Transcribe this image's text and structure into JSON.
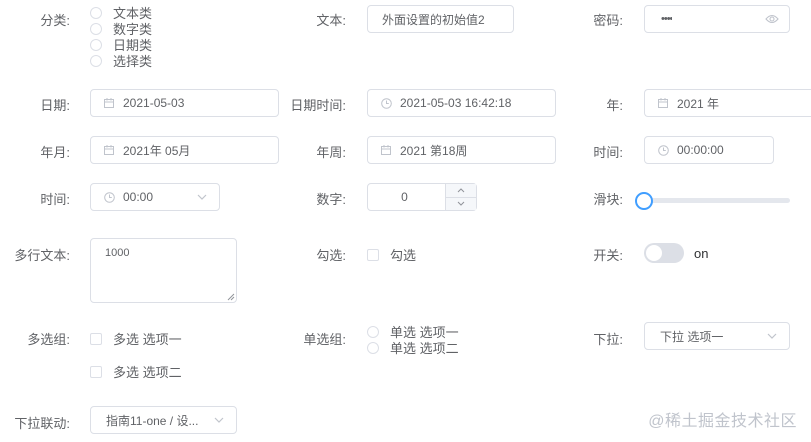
{
  "form": {
    "category": {
      "label": "分类:",
      "options": [
        "文本类",
        "数字类",
        "日期类",
        "选择类"
      ]
    },
    "text": {
      "label": "文本:",
      "value": "外面设置的初始值2"
    },
    "password": {
      "label": "密码:",
      "value": "••••",
      "icon": "eye-icon"
    },
    "date": {
      "label": "日期:",
      "value": "2021-05-03",
      "icon": "calendar-icon"
    },
    "datetime": {
      "label": "日期时间:",
      "value": "2021-05-03 16:42:18",
      "icon": "clock-icon"
    },
    "year": {
      "label": "年:",
      "value": "2021 年",
      "icon": "calendar-icon"
    },
    "month": {
      "label": "年月:",
      "value": "2021年 05月",
      "icon": "calendar-icon"
    },
    "week": {
      "label": "年周:",
      "value": "2021 第18周",
      "icon": "calendar-icon"
    },
    "time": {
      "label": "时间:",
      "value": "00:00:00",
      "icon": "clock-icon"
    },
    "time_select": {
      "label": "时间:",
      "value": "00:00",
      "icon": "clock-icon"
    },
    "number": {
      "label": "数字:",
      "value": "0"
    },
    "slider": {
      "label": "滑块:",
      "value": 0
    },
    "textarea": {
      "label": "多行文本:",
      "value": "1000"
    },
    "checkbox": {
      "label": "勾选:",
      "option": "勾选"
    },
    "switch": {
      "label": "开关:",
      "text": "on",
      "checked": false
    },
    "checkbox_group": {
      "label": "多选组:",
      "options": [
        "多选 选项一",
        "多选 选项二"
      ]
    },
    "radio_group": {
      "label": "单选组:",
      "options": [
        "单选 选项一",
        "单选 选项二"
      ]
    },
    "select": {
      "label": "下拉:",
      "value": "下拉 选项一"
    },
    "cascader": {
      "label": "下拉联动:",
      "value": "指南11-one / 设..."
    }
  },
  "watermark": "@稀土掘金技术社区",
  "colors": {
    "accent": "#409eff",
    "border": "#dcdfe6",
    "text": "#606266",
    "icon": "#c0c4cc"
  }
}
